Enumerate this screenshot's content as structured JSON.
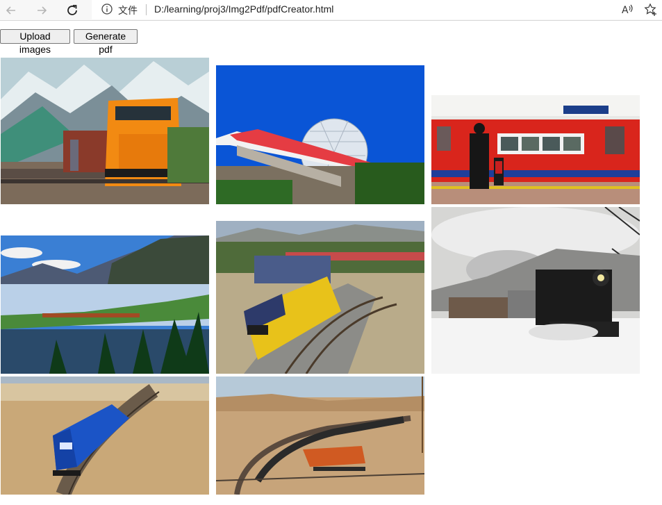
{
  "browser": {
    "scheme_label": "文件",
    "url": "D:/learning/proj3/Img2Pdf/pdfCreator.html",
    "icons": [
      "back-arrow-icon",
      "forward-arrow-icon",
      "refresh-icon",
      "info-icon",
      "read-aloud-icon",
      "add-favorite-icon"
    ]
  },
  "toolbar": {
    "upload_label": "Upload images",
    "generate_label": "Generate pdf"
  },
  "gallery": {
    "images": [
      {
        "subject": "Orange freight locomotive in front of mountains"
      },
      {
        "subject": "Monorail passing geodesic sphere under blue sky"
      },
      {
        "subject": "Red subway train at underground platform with people"
      },
      {
        "subject": "Train along lake with mountains and forest"
      },
      {
        "subject": "Yellow locomotives pulling container train on curve"
      },
      {
        "subject": "Black steam locomotive in snow"
      },
      {
        "subject": "Blue locomotive on curving track in prairie"
      },
      {
        "subject": "Orange locomotives pulling long coal train"
      }
    ]
  }
}
